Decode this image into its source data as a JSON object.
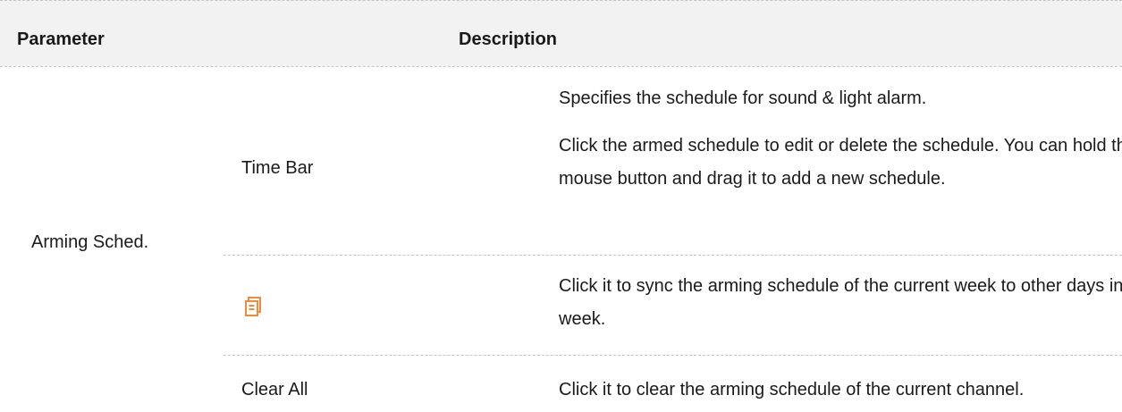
{
  "header": {
    "parameter": "Parameter",
    "description": "Description"
  },
  "group": {
    "label": "Arming Sched."
  },
  "rows": [
    {
      "name": "Time Bar",
      "description": [
        "Specifies the schedule for sound & light alarm.",
        "Click the armed schedule to edit or delete the schedule. You can hold the left mouse button and drag it to add a new schedule."
      ]
    },
    {
      "icon": "copy-schedule-icon",
      "description": [
        "Click it to sync the arming schedule of the current week to other days in the week."
      ]
    },
    {
      "name": "Clear All",
      "description": [
        "Click it to clear the arming schedule of the current channel."
      ]
    }
  ],
  "colors": {
    "header_background": "#f2f2f2",
    "icon_accent": "#f08a3c",
    "divider": "#c4c4c4"
  }
}
